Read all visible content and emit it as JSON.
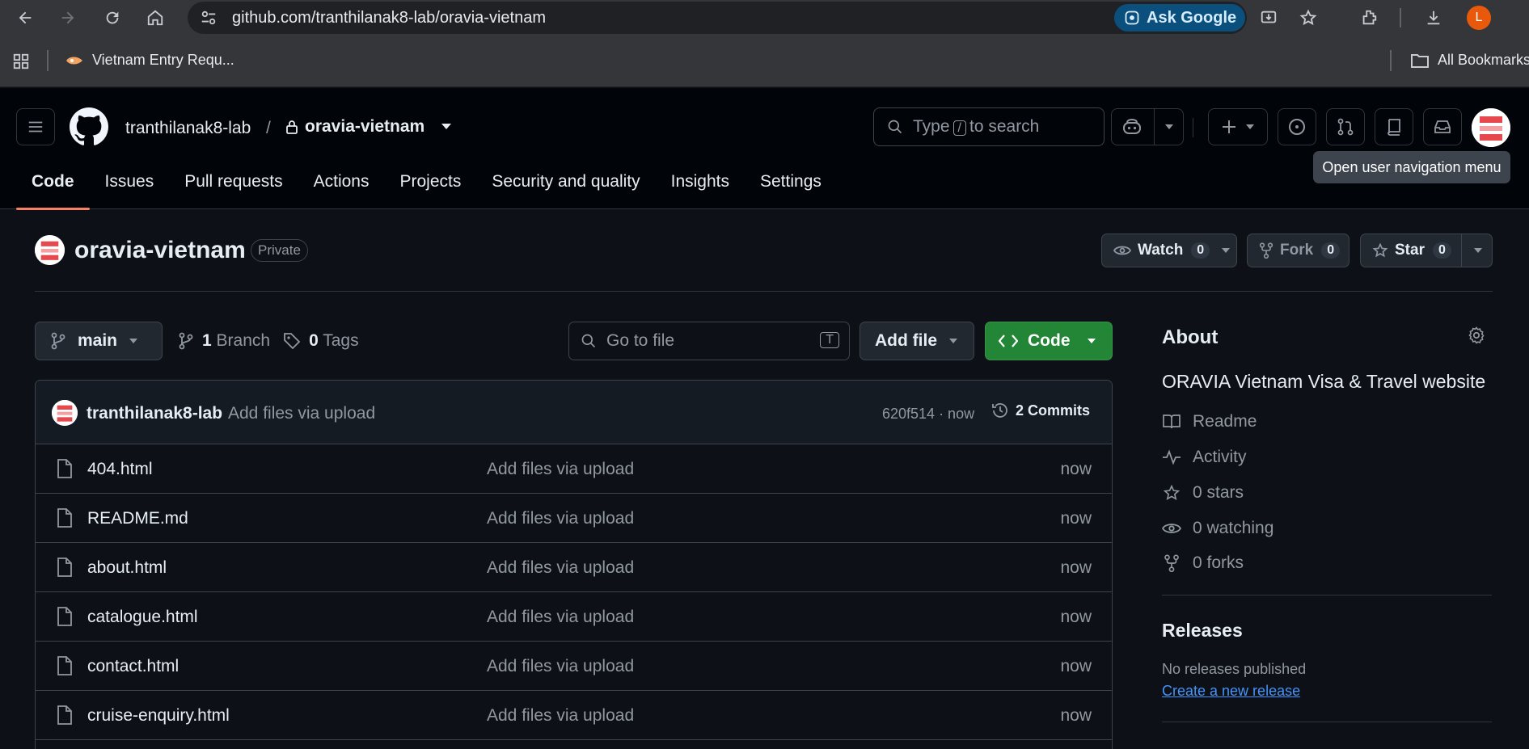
{
  "browser": {
    "url": "github.com/tranthilanak8-lab/oravia-vietnam",
    "ask_google": "Ask Google",
    "profile_initial": "L",
    "bookmark": "Vietnam Entry Requ...",
    "all_bookmarks": "All Bookmarks"
  },
  "header": {
    "owner": "tranthilanak8-lab",
    "separator": "/",
    "repo": "oravia-vietnam",
    "search_prefix": "Type",
    "search_key": "/",
    "search_suffix": "to search",
    "tooltip": "Open user navigation menu"
  },
  "tabs": [
    {
      "label": "Code"
    },
    {
      "label": "Issues"
    },
    {
      "label": "Pull requests"
    },
    {
      "label": "Actions"
    },
    {
      "label": "Projects"
    },
    {
      "label": "Security and quality"
    },
    {
      "label": "Insights"
    },
    {
      "label": "Settings"
    }
  ],
  "repo": {
    "name": "oravia-vietnam",
    "visibility": "Private",
    "watch_label": "Watch",
    "watch_count": "0",
    "fork_label": "Fork",
    "fork_count": "0",
    "star_label": "Star",
    "star_count": "0"
  },
  "toolbar": {
    "branch": "main",
    "branch_count": "1",
    "branch_label": "Branch",
    "tag_count": "0",
    "tag_label": "Tags",
    "goto_placeholder": "Go to file",
    "goto_key": "T",
    "add_file": "Add file",
    "code": "Code"
  },
  "commit": {
    "author": "tranthilanak8-lab",
    "message": "Add files via upload",
    "hash_time": "620f514 · now",
    "commits": "2 Commits"
  },
  "files": [
    {
      "name": "404.html",
      "message": "Add files via upload",
      "time": "now"
    },
    {
      "name": "README.md",
      "message": "Add files via upload",
      "time": "now"
    },
    {
      "name": "about.html",
      "message": "Add files via upload",
      "time": "now"
    },
    {
      "name": "catalogue.html",
      "message": "Add files via upload",
      "time": "now"
    },
    {
      "name": "contact.html",
      "message": "Add files via upload",
      "time": "now"
    },
    {
      "name": "cruise-enquiry.html",
      "message": "Add files via upload",
      "time": "now"
    }
  ],
  "about": {
    "title": "About",
    "description": "ORAVIA Vietnam Visa & Travel website",
    "readme": "Readme",
    "activity": "Activity",
    "stars": "0 stars",
    "watching": "0 watching",
    "forks": "0 forks"
  },
  "releases": {
    "title": "Releases",
    "none": "No releases published",
    "create": "Create a new release"
  },
  "colors": {
    "accent_tab": "#f78166",
    "code_button": "#238636",
    "link": "#4493f8"
  }
}
